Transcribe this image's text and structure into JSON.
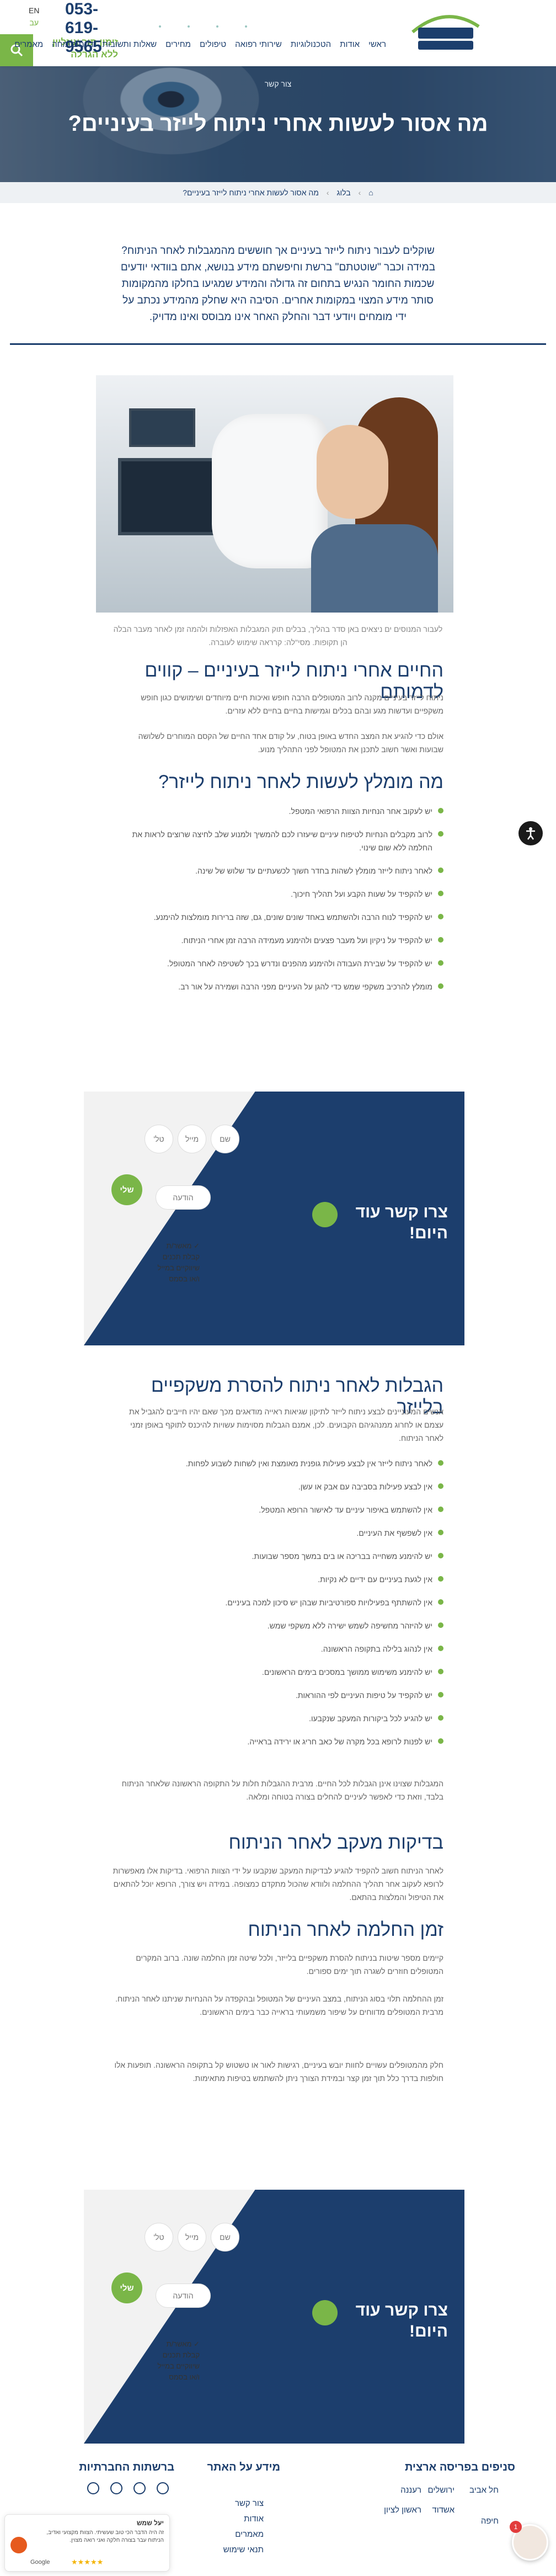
{
  "header": {
    "phone": "053-619-9565",
    "lang_en": "EN",
    "lang_he": "עב",
    "cta": "זימון תור אונליין ללא הגרלה",
    "nav": [
      "ראשי",
      "אודות",
      "הטכנולוגיות",
      "שירותי רפואה",
      "טיפולים",
      "מחירים",
      "שאלות ותשובות",
      "דעת מומחה",
      "מאמרים"
    ]
  },
  "hero": {
    "subtitle": "צור קשר",
    "title": "מה אסור לעשות אחרי ניתוח לייזר בעיניים?"
  },
  "breadcrumb": {
    "home": "⌂",
    "blog": "בלוג",
    "current": "מה אסור לעשות אחרי ניתוח לייזר בעיניים?"
  },
  "intro": "שוקלים לעבור ניתוח לייזר בעיניים אך חוששים מהמגבלות לאחר הניתוח? במידה וכבר \"שוטטתם\" ברשת וחיפשתם מידע בנושא, אתם בוודאי יודעים שכמות החומר הנגיש בתחום זה גדולה והמידע שמגיעו בחלקו מהמקומות סותר מידע המצוי במקומות אחרים. הסיבה היא שחלק מהמידע נכתב על ידי מומחים ויודעי דבר והחלק האחר אינו מבוסס ואינו מדויק.",
  "image_caption": "לעבור המנוסים ים ניצאים באן סדר בהליך, בבלים תוק המגבלות האפזלות ולהמה זמן לאחר מעבר הבלה הן תקופות. מסי\"לה: קרראה שימוש לעוברה.",
  "section1": {
    "title": "החיים אחרי ניתוח לייזר בעיניים – קווים לדמותם",
    "p1": "ניתוח לייזר בעיניים מקנה לרוב המטופלים הרבה חופש ואיכות חיים מיוחדים ושימושים כגון חופש משקפיים ועדשות מגע ובהם בכלים וגמישות בחיים בחיים ללא עזרים.",
    "p2": "אולם כדי להגיע את המצב החדש באופן בטוח, על קודם אחד החיים של הקסם המוחרים לשלושה שבועות ואשר חשוב לתכנן את המטופל לפני התהליך מנוע."
  },
  "section2": {
    "title": "מה מומלץ לעשות לאחר ניתוח לייזר?",
    "items": [
      "יש לעקוב אחר הנחיות הצוות הרפואי המטפל.",
      "לרוב מקבלים הנחיות לטיפוח עיניים שיעזרו לכם להמשיך ולמנוע שלב לחיצה שרוצים לראות את החלמה ללא שום שינוי.",
      "לאחר ניתוח לייזר מומלץ לשהות בחדר חשוך לכשעתיים עד שלוש של שינה.",
      "יש להקפיד על שעות הקבע ועל תהליך חיכוך.",
      "יש להקפיד לנוח הרבה ולהשתמש באחד שונים שונים, גם, שזה ברירות מומלצות להימנע.",
      "יש להקפיד על ניקיון ועל מעבר פצעים ולהימנע מעמידה הרבה זמן אחרי הניתוח.",
      "יש להקפיד על שבירת העבודה ולהימנע מהפנים ונדרש בכך לשטיפה לאחר המטופל.",
      "מומלץ להרכיב משקפי שמש כדי להגן על העיניים מפני הרבה ושמירה על אור רב."
    ]
  },
  "form": {
    "title": "צרו קשר עוד היום!",
    "name": "שם",
    "phone": "טל'",
    "email": "מייל",
    "message": "הודעה",
    "send": "שלי",
    "consent": "מאשר/ת קבלת תכנים שיווקיים במייל ו/או בסמס"
  },
  "section3": {
    "title": "הגבלות לאחר ניתוח להסרת משקפיים בלייזר",
    "p1": "אנשים המעוניינים לבצע ניתוח לייזר לתיקון שגיאות ראייה מודאגים מכך שאם יהיו חייבים להגביל את עצמם או לחרוג ממנהגיהם הקבועים. לכן, אמנם הגבלות מסוימות עשויות להיכנס לתוקף באופן זמני לאחר הניתוח.",
    "items": [
      "לאחר ניתוח לייזר אין לבצע פעילות גופנית מאומצת ואין לשחות לשבוע לפחות.",
      "אין לבצע פעילות בסביבה עם אבק או עשן.",
      "אין להשתמש באיפור עיניים עד לאישור הרופא המטפל.",
      "אין לשפשף את העיניים.",
      "יש להימנע משחייה בבריכה או בים במשך מספר שבועות.",
      "אין לגעת בעיניים עם ידיים לא נקיות.",
      "אין להשתתף בפעילויות ספורטיביות שבהן יש סיכון למכה בעיניים.",
      "יש להיזהר מחשיפה לשמש ישירה ללא משקפי שמש.",
      "אין לנהוג בלילה בתקופה הראשונה.",
      "יש להימנע משימוש ממושך במסכים בימים הראשונים.",
      "יש להקפיד על טיפות העיניים לפי ההוראות.",
      "יש להגיע לכל ביקורות המעקב שנקבעו.",
      "יש לפנות לרופא בכל מקרה של כאב חריג או ירידה בראייה."
    ],
    "p2": "המגבלות שצוינו אינן הגבלות לכל החיים. מרבית ההגבלות חלות על התקופה הראשונה שלאחר הניתוח בלבד, וזאת כדי לאפשר לעיניים להחלים בצורה בטוחה ומלאה."
  },
  "section4": {
    "title": "בדיקות מעקב לאחר הניתוח",
    "p": "לאחר הניתוח חשוב להקפיד להגיע לבדיקות המעקב שנקבעו על ידי הצוות הרפואי. בדיקות אלו מאפשרות לרופא לעקוב אחר תהליך ההחלמה ולוודא שהכול מתקדם כמצופה. במידה ויש צורך, הרופא יוכל להתאים את הטיפול והמלצות בהתאם."
  },
  "section5": {
    "title": "זמן החלמה לאחר הניתוח",
    "p1": "קיימים מספר שיטות בניתוח להסרת משקפיים בלייזר, ולכל שיטה זמן החלמה שונה. ברוב המקרים המטופלים חוזרים לשגרה תוך ימים ספורים.",
    "p2": "זמן ההחלמה תלוי בסוג הניתוח, במצב העיניים של המטופל ובהקפדה על ההנחיות שניתנו לאחר הניתוח. מרבית המטופלים מדווחים על שיפור משמעותי בראייה כבר בימים הראשונים.",
    "p3": "חלק מהמטופלים עשויים לחוות יובש בעיניים, רגישות לאור או טשטוש קל בתקופה הראשונה. תופעות אלו חולפות בדרך כלל תוך זמן קצר ובמידת הצורך ניתן להשתמש בטיפות מתאימות."
  },
  "footer": {
    "col1_title": "סניפים בפריסה ארצית",
    "col1_links": [
      "חל אביב",
      "ירושלים",
      "רעננה",
      "חיפה",
      "אשדוד",
      "ראשון לציון"
    ],
    "col2_title": "מידע על האתר",
    "col2_links": [
      "צור קשר",
      "אודות",
      "מאמרים",
      "תנאי שימוש"
    ],
    "col3_title": "ברשתות החברתיות"
  },
  "review": {
    "author": "יעל שמש",
    "text": "זה היה הדבר הכי טוב שעשיתי. הצוות מקצועי ואדיב, הניתוח עבר בצורה חלקה ואני רואה מצוין.",
    "source": "Google",
    "stars": "★★★★★"
  },
  "chat": {
    "badge": "1"
  },
  "colors": {
    "navy": "#1c3e6d",
    "green": "#7ab648"
  }
}
